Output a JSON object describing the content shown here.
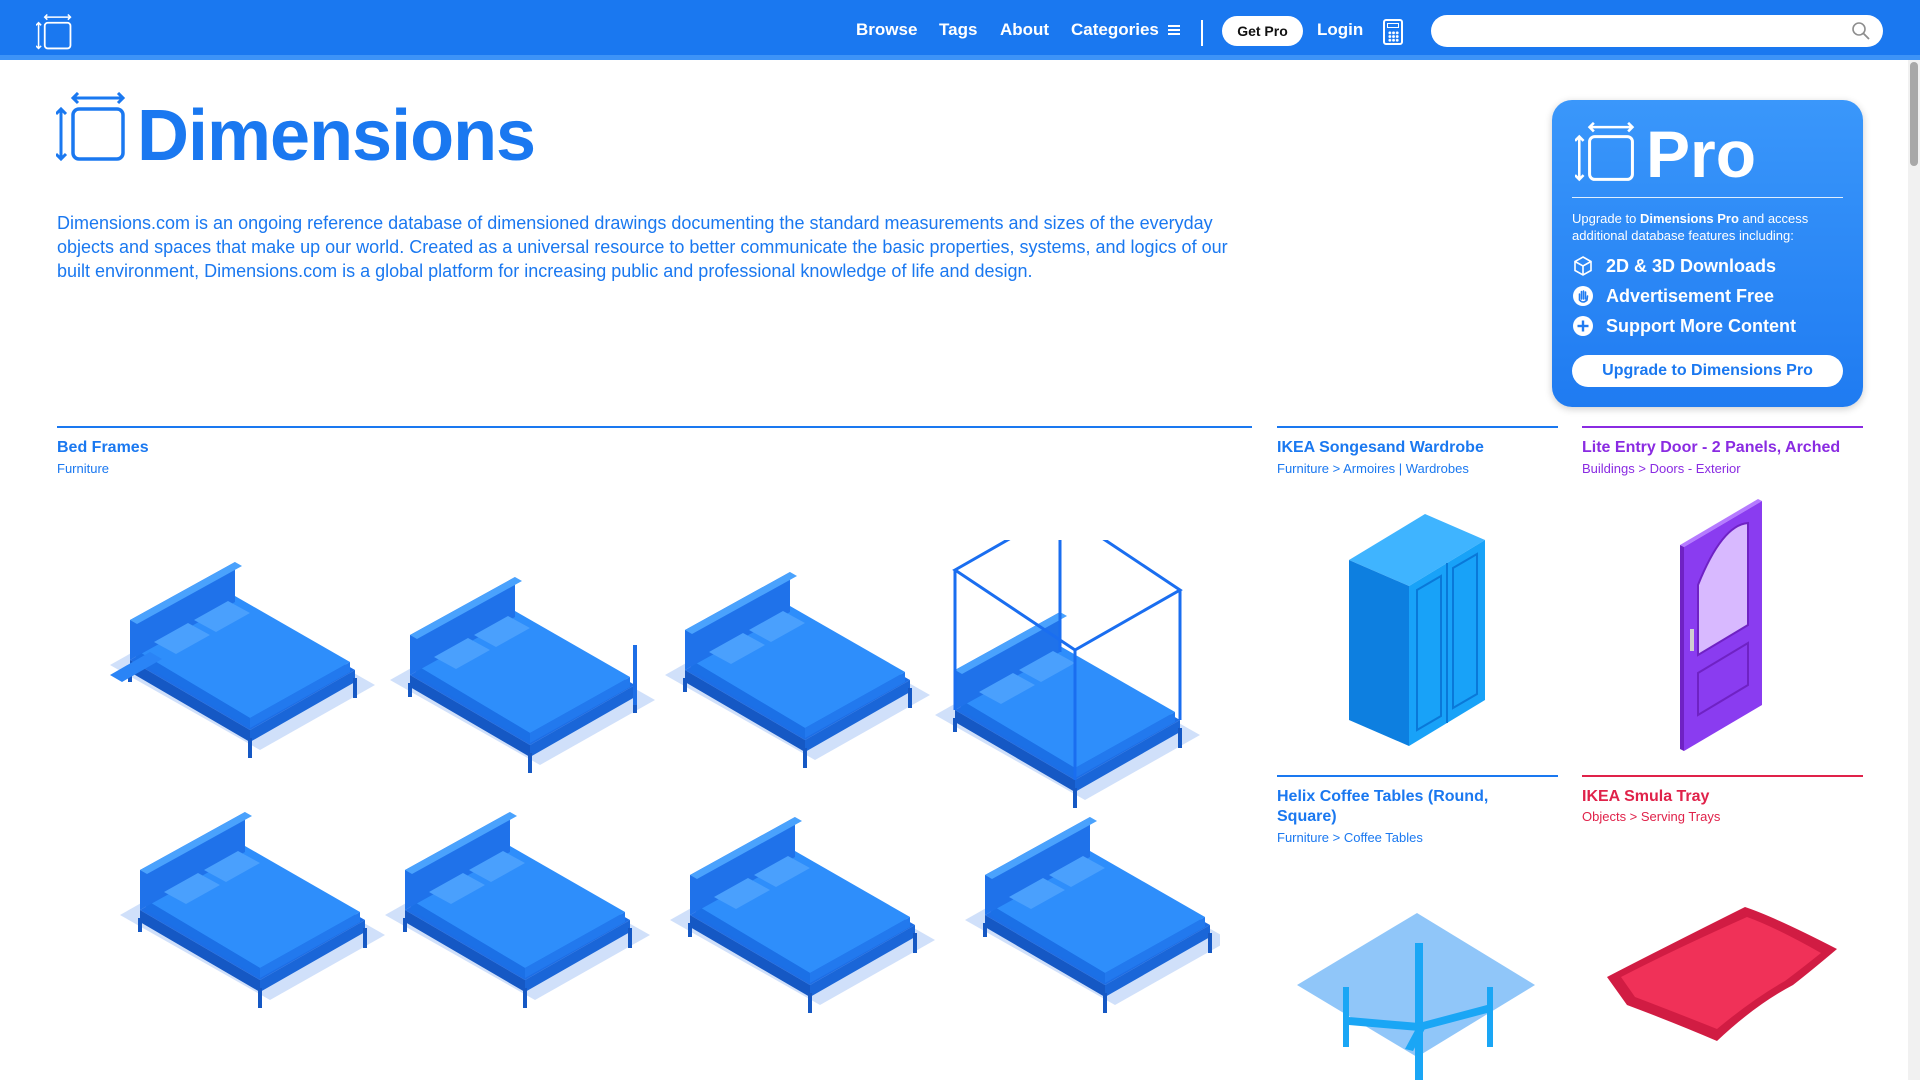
{
  "nav": {
    "browse": "Browse",
    "tags": "Tags",
    "about": "About",
    "categories": "Categories",
    "get_pro": "Get Pro",
    "login": "Login",
    "search_placeholder": ""
  },
  "hero": {
    "title": "Dimensions",
    "description": "Dimensions.com is an ongoing reference database of dimensioned drawings documenting the standard measurements and sizes of the everyday objects and spaces that make up our world. Created as a universal resource to better communicate the basic properties, systems, and logics of our built environment, Dimensions.com is a global platform for increasing public and professional knowledge of life and design."
  },
  "pro": {
    "title": "Pro",
    "intro_prefix": "Upgrade to ",
    "intro_bold": "Dimensions Pro",
    "intro_suffix": " and access additional database features including:",
    "features": [
      "2D & 3D Downloads",
      "Advertisement Free",
      "Support More Content"
    ],
    "button": "Upgrade to Dimensions Pro"
  },
  "cards": [
    {
      "title": "Bed Frames",
      "category": "Furniture",
      "color": "#1a78f0"
    },
    {
      "title": "IKEA Songesand Wardrobe",
      "category": "Furniture > Armoires | Wardrobes",
      "color": "#1a78f0"
    },
    {
      "title": "Lite Entry Door - 2 Panels, Arched",
      "category": "Buildings > Doors - Exterior",
      "color": "#8a2be2"
    },
    {
      "title": "Helix Coffee Tables (Round, Square)",
      "category": "Furniture > Coffee Tables",
      "color": "#1a78f0"
    },
    {
      "title": "IKEA Smula Tray",
      "category": "Objects > Serving Trays",
      "color": "#e0224a"
    }
  ],
  "colors": {
    "brand_blue": "#1a78f0",
    "door_purple": "#8a2be2",
    "tray_red": "#e0224a"
  }
}
